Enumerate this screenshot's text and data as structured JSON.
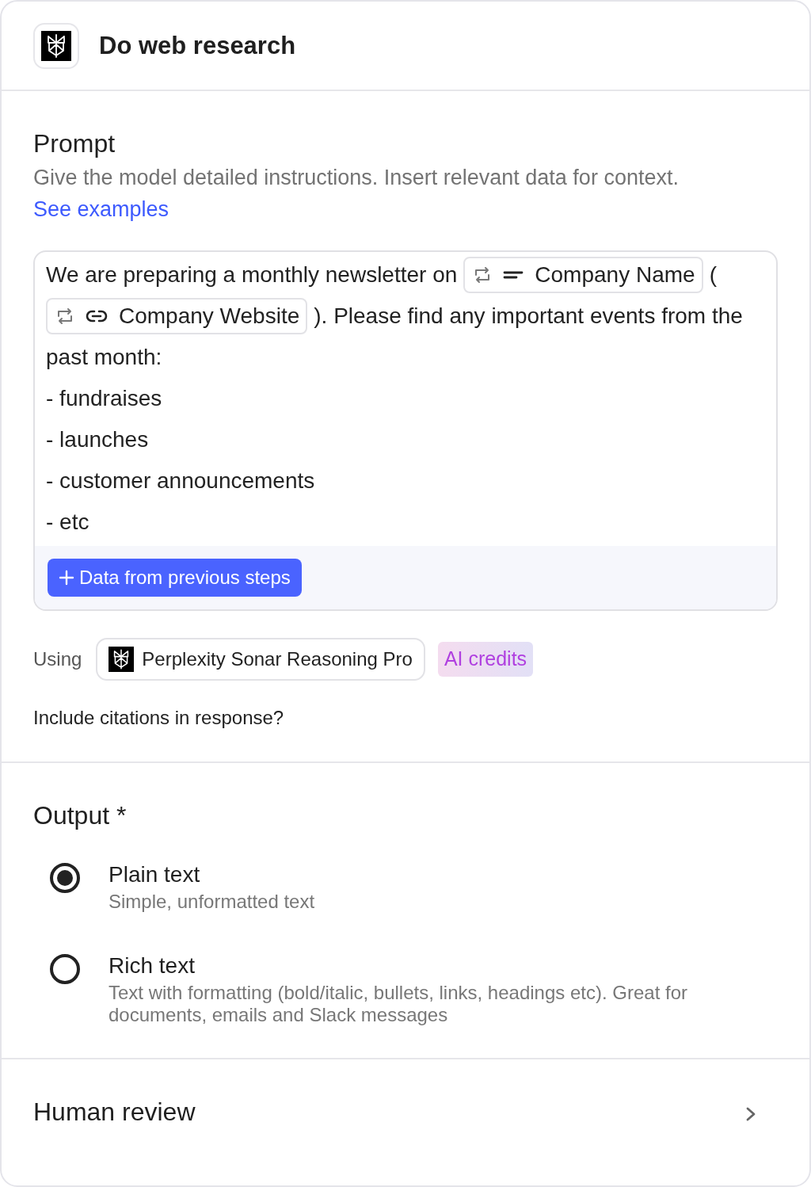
{
  "header": {
    "title": "Do web research"
  },
  "prompt": {
    "title": "Prompt",
    "description": "Give the model detailed instructions. Insert relevant data for context.",
    "link": "See examples",
    "editor": {
      "lines": [
        [
          {
            "kind": "text",
            "text": "We are preparing a monthly newsletter on"
          },
          {
            "kind": "field",
            "label": "Company Name"
          },
          {
            "kind": "text",
            "text": "("
          }
        ],
        [
          {
            "kind": "link",
            "label": "Company Website"
          },
          {
            "kind": "text",
            "text": "). Please find any important events from the"
          }
        ],
        [
          {
            "kind": "text",
            "text": "past month:"
          }
        ],
        [
          {
            "kind": "text",
            "text": "- fundraises"
          }
        ],
        [
          {
            "kind": "text",
            "text": "- launches"
          }
        ],
        [
          {
            "kind": "text",
            "text": "- customer announcements"
          }
        ],
        [
          {
            "kind": "text",
            "text": "- etc"
          }
        ]
      ],
      "add_button": "Data from previous steps"
    },
    "model": {
      "label": "Using",
      "name": "Perplexity Sonar Reasoning Pro",
      "badge": "AI credits"
    },
    "citations": {
      "label": "Include citations in response?"
    }
  },
  "output": {
    "title": "Output *",
    "options": [
      {
        "label": "Plain text",
        "description": "Simple, unformatted text",
        "selected": true
      },
      {
        "label": "Rich text",
        "description": "Text with formatting (bold/italic, bullets, links, headings etc). Great for documents, emails and Slack messages",
        "selected": false
      }
    ]
  },
  "human_review": {
    "title": "Human review",
    "expanded": false
  }
}
